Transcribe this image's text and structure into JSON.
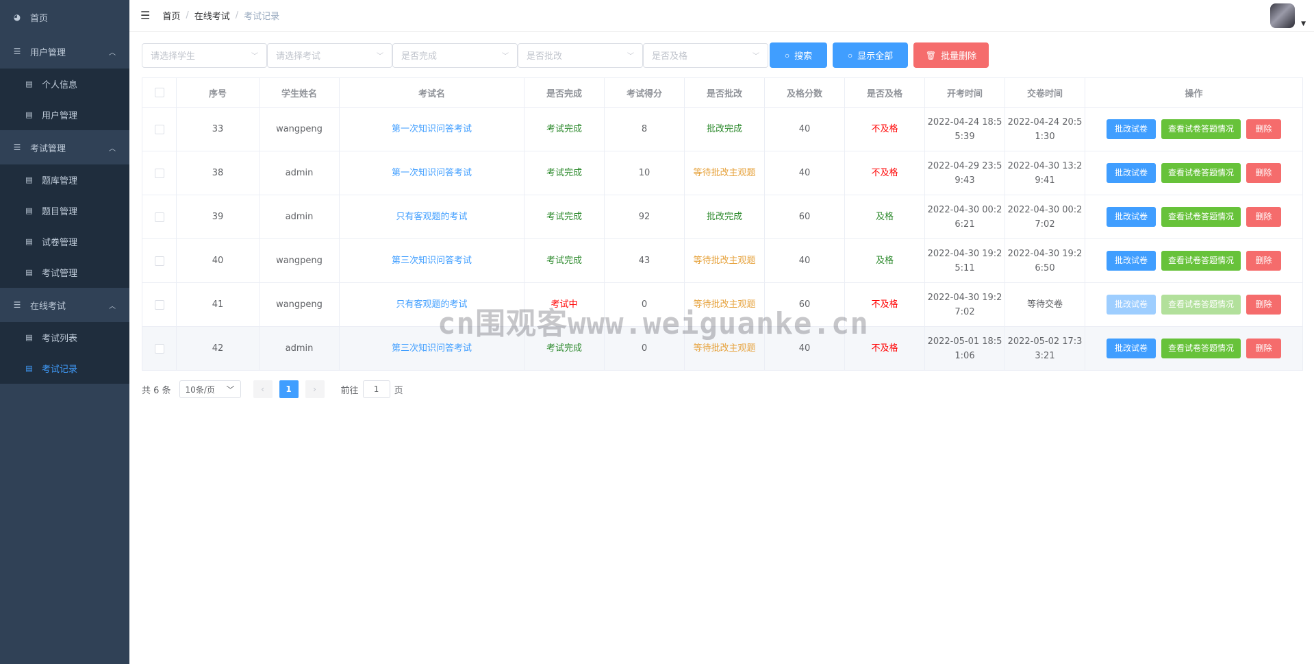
{
  "sidebar": {
    "home": "首页",
    "groups": [
      {
        "label": "用户管理",
        "items": [
          "个人信息",
          "用户管理"
        ]
      },
      {
        "label": "考试管理",
        "items": [
          "题库管理",
          "题目管理",
          "试卷管理",
          "考试管理"
        ]
      },
      {
        "label": "在线考试",
        "items": [
          "考试列表",
          "考试记录"
        ]
      }
    ]
  },
  "breadcrumb": [
    "首页",
    "在线考试",
    "考试记录"
  ],
  "filters": {
    "student_placeholder": "请选择学生",
    "exam_placeholder": "请选择考试",
    "finished_placeholder": "是否完成",
    "marked_placeholder": "是否批改",
    "passed_placeholder": "是否及格",
    "search_label": "搜索",
    "show_all_label": "显示全部",
    "batch_delete_label": "批量删除"
  },
  "table": {
    "headers": [
      "序号",
      "学生姓名",
      "考试名",
      "是否完成",
      "考试得分",
      "是否批改",
      "及格分数",
      "是否及格",
      "开考时间",
      "交卷时间",
      "操作"
    ],
    "rows": [
      {
        "id": "33",
        "student": "wangpeng",
        "exam": "第一次知识问答考试",
        "finished": "考试完成",
        "score": "8",
        "marked": "批改完成",
        "pass_score": "40",
        "passed": "不及格",
        "start_a": "2022-04-24 18:5",
        "start_b": "5:39",
        "submit_a": "2022-04-24 20:5",
        "submit_b": "1:30"
      },
      {
        "id": "38",
        "student": "admin",
        "exam": "第一次知识问答考试",
        "finished": "考试完成",
        "score": "10",
        "marked": "等待批改主观题",
        "pass_score": "40",
        "passed": "不及格",
        "start_a": "2022-04-29 23:5",
        "start_b": "9:43",
        "submit_a": "2022-04-30 13:2",
        "submit_b": "9:41"
      },
      {
        "id": "39",
        "student": "admin",
        "exam": "只有客观题的考试",
        "finished": "考试完成",
        "score": "92",
        "marked": "批改完成",
        "pass_score": "60",
        "passed": "及格",
        "start_a": "2022-04-30 00:2",
        "start_b": "6:21",
        "submit_a": "2022-04-30 00:2",
        "submit_b": "7:02"
      },
      {
        "id": "40",
        "student": "wangpeng",
        "exam": "第三次知识问答考试",
        "finished": "考试完成",
        "score": "43",
        "marked": "等待批改主观题",
        "pass_score": "40",
        "passed": "及格",
        "start_a": "2022-04-30 19:2",
        "start_b": "5:11",
        "submit_a": "2022-04-30 19:2",
        "submit_b": "6:50"
      },
      {
        "id": "41",
        "student": "wangpeng",
        "exam": "只有客观题的考试",
        "finished": "考试中",
        "score": "0",
        "marked": "等待批改主观题",
        "pass_score": "60",
        "passed": "不及格",
        "start_a": "2022-04-30 19:2",
        "start_b": "7:02",
        "submit_a": "等待交卷",
        "submit_b": ""
      },
      {
        "id": "42",
        "student": "admin",
        "exam": "第三次知识问答考试",
        "finished": "考试完成",
        "score": "0",
        "marked": "等待批改主观题",
        "pass_score": "40",
        "passed": "不及格",
        "start_a": "2022-05-01 18:5",
        "start_b": "1:06",
        "submit_a": "2022-05-02 17:3",
        "submit_b": "3:21"
      }
    ],
    "ops": {
      "mark": "批改试卷",
      "view": "查看试卷答题情况",
      "delete": "删除"
    }
  },
  "pagination": {
    "total": "共 6 条",
    "page_size": "10条/页",
    "current_page": "1",
    "goto_label": "前往",
    "goto_value": "1",
    "page_unit": "页"
  },
  "watermark": "cn围观客www.weiguanke.cn",
  "colors": {
    "sidebar_bg": "#304156",
    "submenu_bg": "#1f2d3d",
    "primary": "#409eff",
    "success": "#67c23a",
    "warning": "#e6a23c",
    "danger": "#f56c6c"
  }
}
